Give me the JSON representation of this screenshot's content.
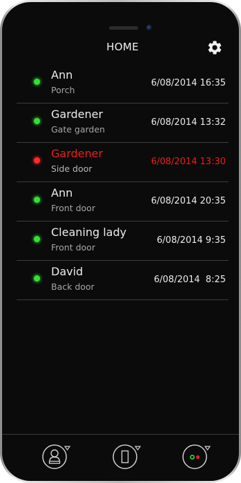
{
  "header": {
    "title": "HOME",
    "settings_icon": "gear-icon"
  },
  "colors": {
    "background": "#0b0b0b",
    "status_ok": "#32e234",
    "status_alert": "#ee1c1c",
    "text_primary": "#ececec",
    "text_secondary": "#a7a7a7",
    "divider": "#3c3c3c"
  },
  "events": [
    {
      "name": "Ann",
      "place": "Porch",
      "time": "6/08/2014 16:35",
      "status": "ok"
    },
    {
      "name": "Gardener",
      "place": "Gate garden",
      "time": "6/08/2014 13:32",
      "status": "ok"
    },
    {
      "name": "Gardener",
      "place": "Side door",
      "time": "6/08/2014 13:30",
      "status": "alert"
    },
    {
      "name": "Ann",
      "place": "Front door",
      "time": "6/08/2014 20:35",
      "status": "ok"
    },
    {
      "name": "Cleaning lady",
      "place": "Front door",
      "time": "6/08/2014 9:35",
      "status": "ok"
    },
    {
      "name": "David",
      "place": "Back door",
      "time": "6/08/2014  8:25",
      "status": "ok"
    }
  ],
  "tabbar": {
    "tabs": [
      {
        "icon": "user-badge-icon"
      },
      {
        "icon": "door-icon"
      },
      {
        "icon": "status-lights-icon"
      }
    ]
  }
}
